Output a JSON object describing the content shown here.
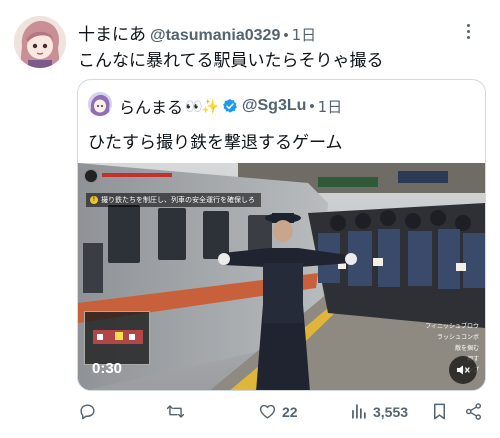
{
  "tweet": {
    "display_name": "十まにあ",
    "handle": "@tasumania0329",
    "separator": "•",
    "time": "1日",
    "text": "こんなに暴れてる駅員いたらそりゃ撮る"
  },
  "quote": {
    "display_name": "らんまる",
    "emoji": "👀✨",
    "handle": "@Sg3Lu",
    "separator": "•",
    "time": "1日",
    "text": "ひたすら撮り鉄を撃退するゲーム",
    "verified_color": "#1d9bf0"
  },
  "video": {
    "hud_objective": "撮り鉄たちを制圧し、列車の安全運行を確保しろ",
    "timer": "0:30",
    "hud_actions": [
      "フィニッシュブロウ",
      "ラッシュコンボ",
      "敵を掴む",
      "押す",
      "ジャンプ"
    ]
  },
  "actions": {
    "reply_count": "",
    "retweet_count": "",
    "like_count": "22",
    "view_count": "3,553"
  },
  "colors": {
    "secondary_text": "#536471",
    "border": "#cfd9de"
  }
}
